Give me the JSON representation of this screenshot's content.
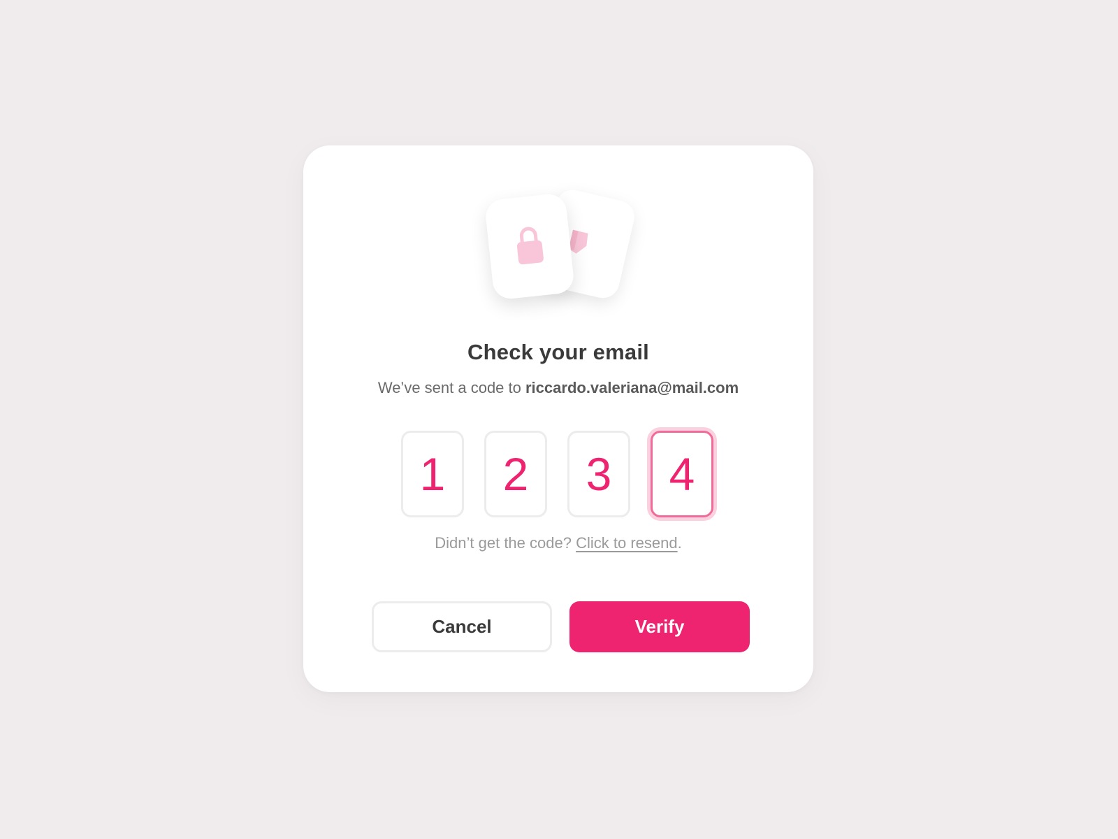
{
  "dialog": {
    "title": "Check your email",
    "subtitle_prefix": "We’ve sent a code to ",
    "email": "riccardo.valeriana@mail.com",
    "icons": [
      "tag-icon",
      "lock-icon"
    ]
  },
  "otp": {
    "digits": [
      "1",
      "2",
      "3",
      "4"
    ],
    "active_index": 3
  },
  "resend": {
    "prompt": "Didn’t get the code? ",
    "link_label": "Click to resend",
    "suffix": "."
  },
  "actions": {
    "cancel_label": "Cancel",
    "verify_label": "Verify"
  },
  "colors": {
    "accent": "#ee2470",
    "background": "#f0ecee",
    "icon_tint": "#f8c6d8"
  }
}
